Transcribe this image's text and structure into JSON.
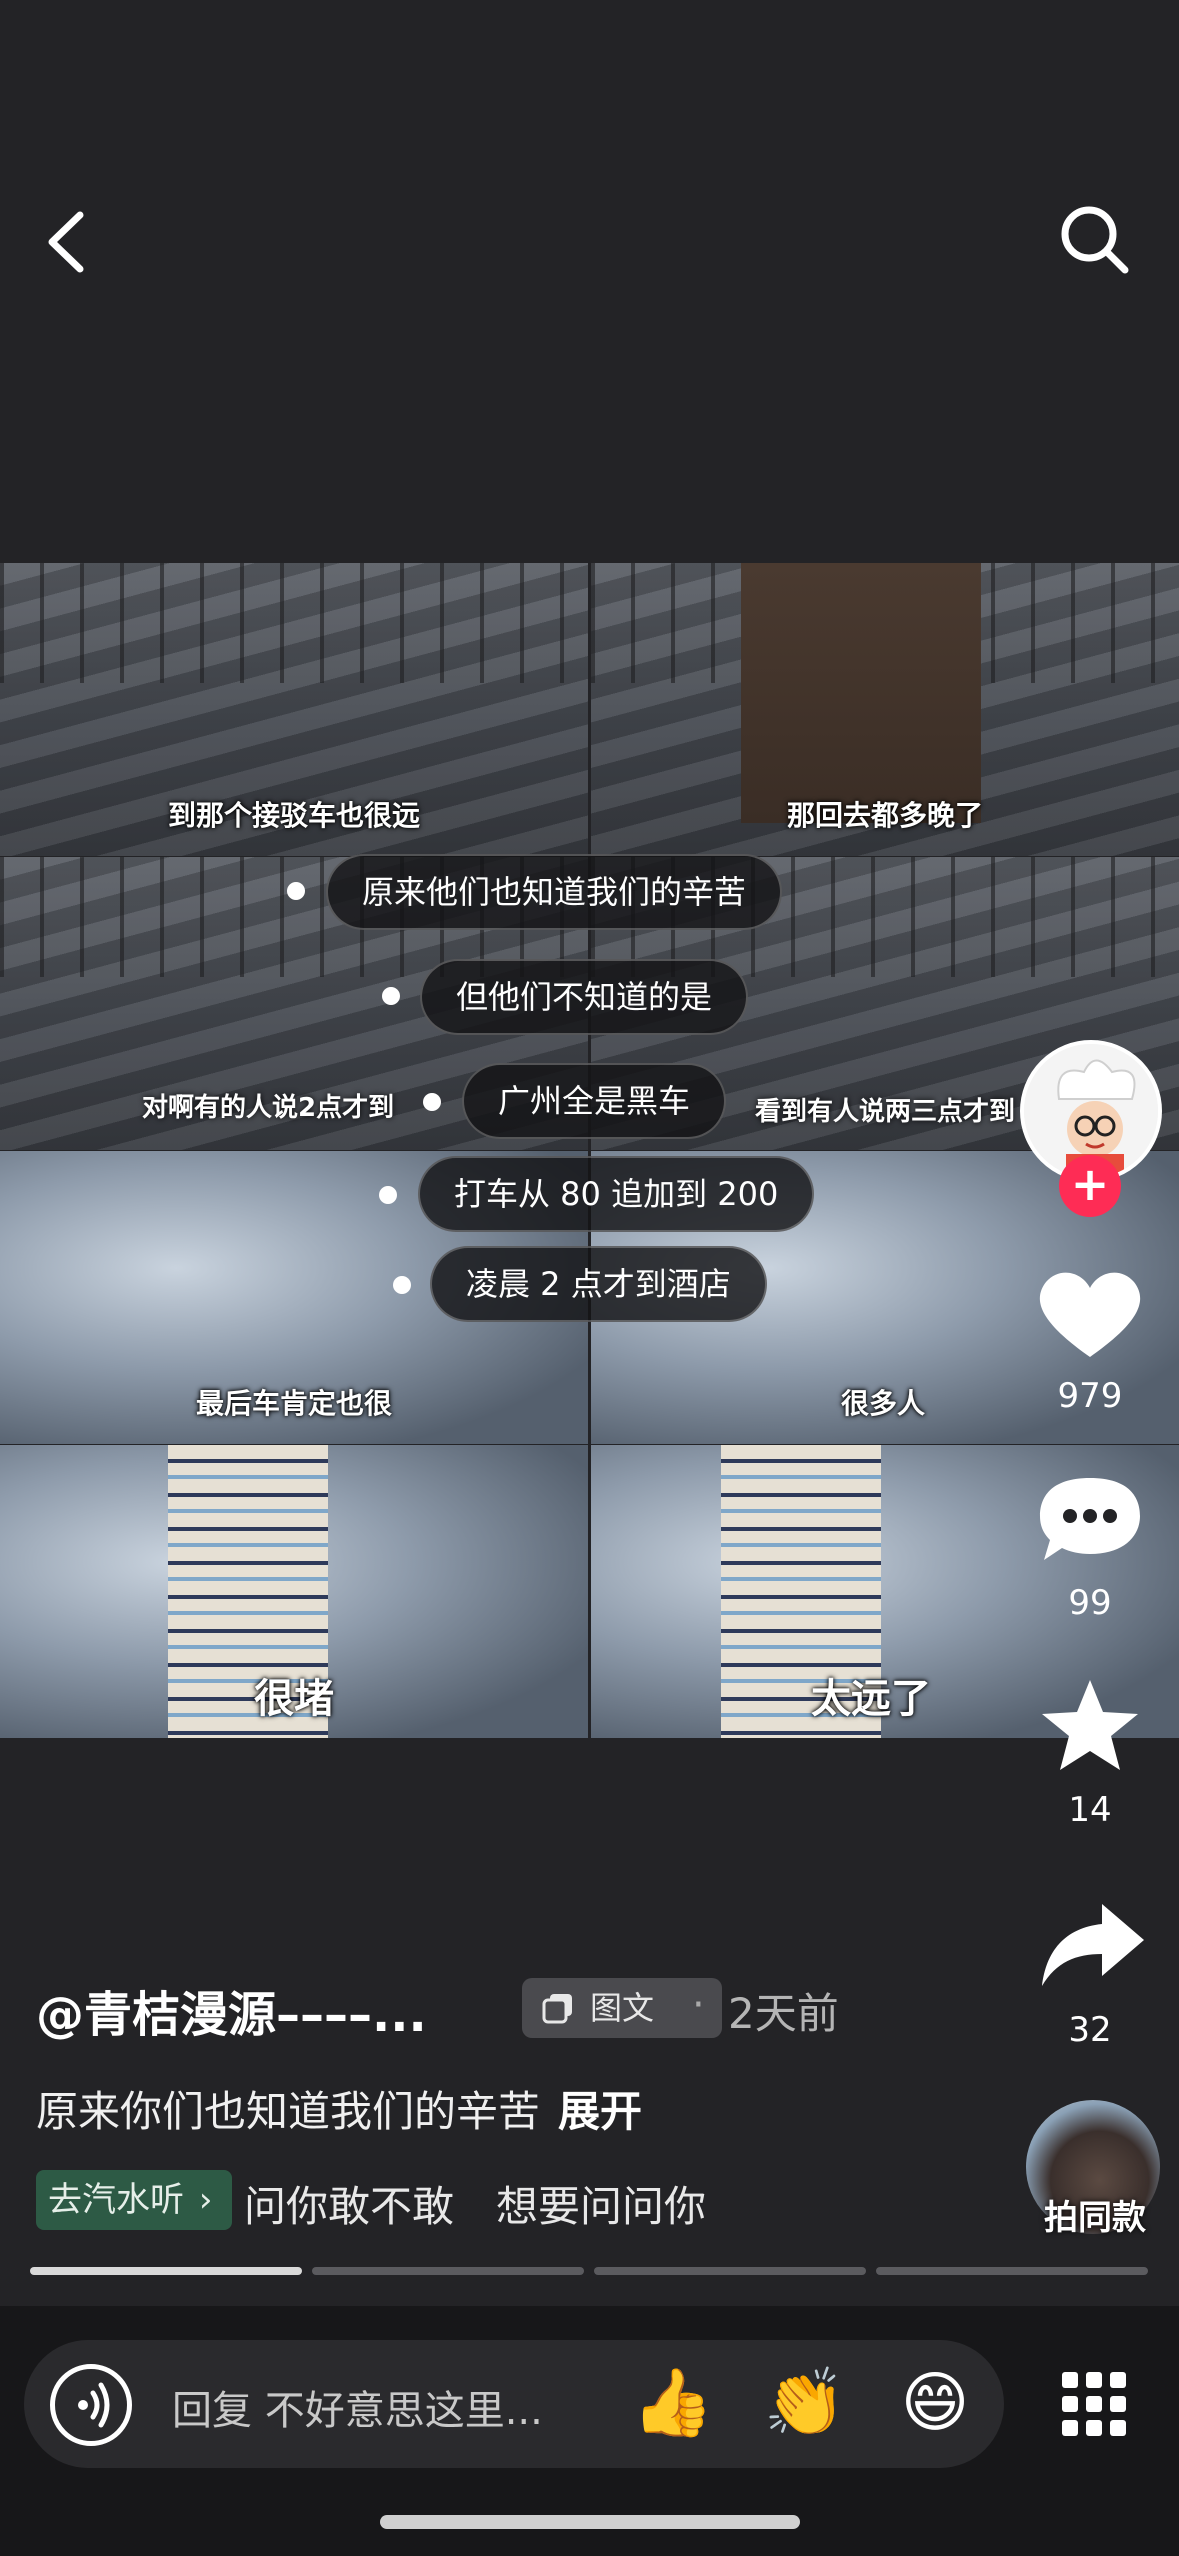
{
  "header": {
    "back_icon": "chevron-left-icon",
    "search_icon": "search-icon"
  },
  "collage": {
    "row1": {
      "left_caption": "到那个接驳车也很远",
      "right_caption": "那回去都多晚了"
    },
    "row2": {
      "left_caption": "对啊有的人说2点才到",
      "right_caption": "看到有人说两三点才到"
    },
    "row3": {
      "left_caption": "最后车肯定也很",
      "right_caption": "很多人"
    },
    "row4": {
      "left_caption": "很堵",
      "right_caption": "太远了"
    },
    "chips": [
      "原来他们也知道我们的辛苦",
      "但他们不知道的是",
      "广州全是黑车",
      "打车从 80 追加到 200",
      "凌晨 2 点才到酒店"
    ]
  },
  "actions": {
    "likes": "979",
    "comments": "99",
    "favorites": "14",
    "shares": "32",
    "like_icon": "heart-icon",
    "comment_icon": "comment-icon",
    "favorite_icon": "star-icon",
    "share_icon": "share-icon",
    "follow_icon": "plus-icon"
  },
  "post": {
    "author": "@青桔漫源––––...",
    "type_badge": "图文",
    "separator": "·",
    "time": "2天前",
    "description": "原来你们也知道我们的辛苦",
    "expand": "展开",
    "music_tag": "去汽水听",
    "music_name": "问你敢不敢　想要问问你",
    "same_style": "拍同款"
  },
  "progress": {
    "pages": 4,
    "current": 1
  },
  "footer": {
    "reply_placeholder": "回复 不好意思这里...",
    "emojis": [
      "👍",
      "👏",
      "😄"
    ],
    "voice_icon": "voice-icon",
    "menu_icon": "grid-menu-icon"
  },
  "colors": {
    "accent": "#fe2c55",
    "music_tag_bg": "#2d5a45",
    "background": "#232326"
  }
}
